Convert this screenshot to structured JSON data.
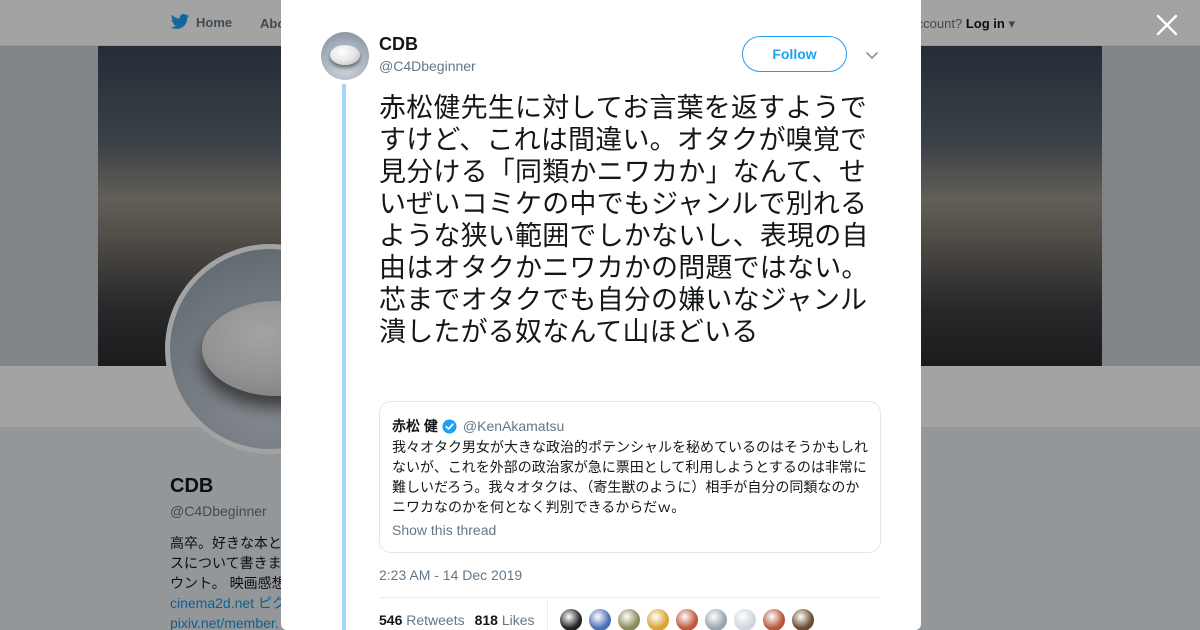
{
  "background": {
    "nav": {
      "home_label": "Home",
      "about_label": "Abo",
      "account_prompt": "ccount?",
      "login_label": "Log in"
    },
    "profile": {
      "name": "CDB",
      "handle": "@C4Dbeginner",
      "bio_lines": [
        "高卒。好きな本と",
        "スについて書きま",
        "ウント。 映画感想"
      ],
      "links": [
        "cinema2d.net ピク",
        "pixiv.net/member."
      ]
    }
  },
  "modal": {
    "author": {
      "name": "CDB",
      "handle": "@C4Dbeginner"
    },
    "follow_label": "Follow",
    "tweet_text": "赤松健先生に対してお言葉を返すようですけど、これは間違い。オタクが嗅覚で見分ける「同類かニワカか」なんて、せいぜいコミケの中でもジャンルで別れるような狭い範囲でしかないし、表現の自由はオタクかニワカかの問題ではない。芯までオタクでも自分の嫌いなジャンル潰したがる奴なんて山ほどいる",
    "quote": {
      "name": "赤松 健",
      "handle": "@KenAkamatsu",
      "text": "我々オタク男女が大きな政治的ポテンシャルを秘めているのはそうかもしれないが、これを外部の政治家が急に票田として利用しようとするのは非常に難しいだろう。我々オタクは、（寄生獣のように）相手が自分の同類なのかニワカなのかを何となく判別できるからだｗ。",
      "show_thread": "Show this thread"
    },
    "timestamp": "2:23 AM - 14 Dec 2019",
    "stats": {
      "retweets_count": "546",
      "retweets_label": "Retweets",
      "likes_count": "818",
      "likes_label": "Likes"
    },
    "liker_colors": [
      "#222222",
      "#4a6fb5",
      "#8a8a5a",
      "#d9a233",
      "#c0563a",
      "#9aa5ad",
      "#cfd6dd",
      "#b5553c",
      "#6b4a2e"
    ]
  },
  "colors": {
    "accent": "#1da1f2",
    "thread_line": "#a3d6f6"
  }
}
